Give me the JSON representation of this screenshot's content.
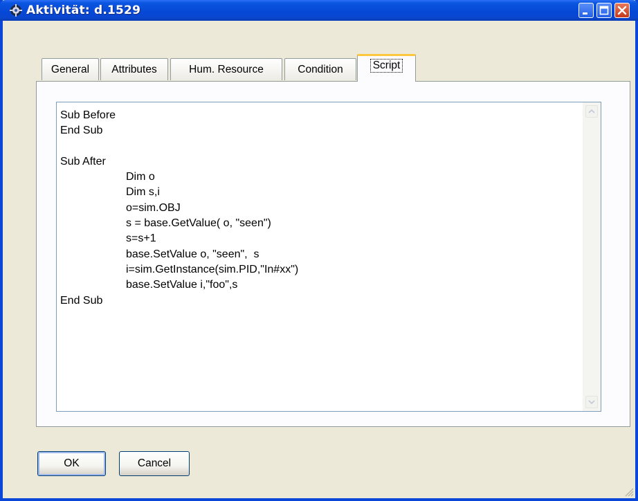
{
  "window": {
    "title": "Aktivität: d.1529",
    "icon": "gear-app-icon"
  },
  "tabs": [
    {
      "label": "General"
    },
    {
      "label": "Attributes"
    },
    {
      "label": "Hum. Resource"
    },
    {
      "label": "Condition"
    },
    {
      "label": "Script",
      "selected": true
    }
  ],
  "script": {
    "lines": [
      "Sub Before",
      "End Sub",
      "",
      "Sub After",
      "Dim o",
      "Dim s,i",
      "o=sim.OBJ",
      "s = base.GetValue( o, \"seen\")",
      "s=s+1",
      "base.SetValue o, \"seen\",  s",
      "i=sim.GetInstance(sim.PID,\"In#xx\")",
      "base.SetValue i,\"foo\",s",
      "End Sub"
    ]
  },
  "buttons": {
    "ok": "OK",
    "cancel": "Cancel"
  },
  "colors": {
    "titlebar": "#0648d6",
    "window_bg": "#ece9d8",
    "active_tab_accent": "#ffc83c"
  }
}
